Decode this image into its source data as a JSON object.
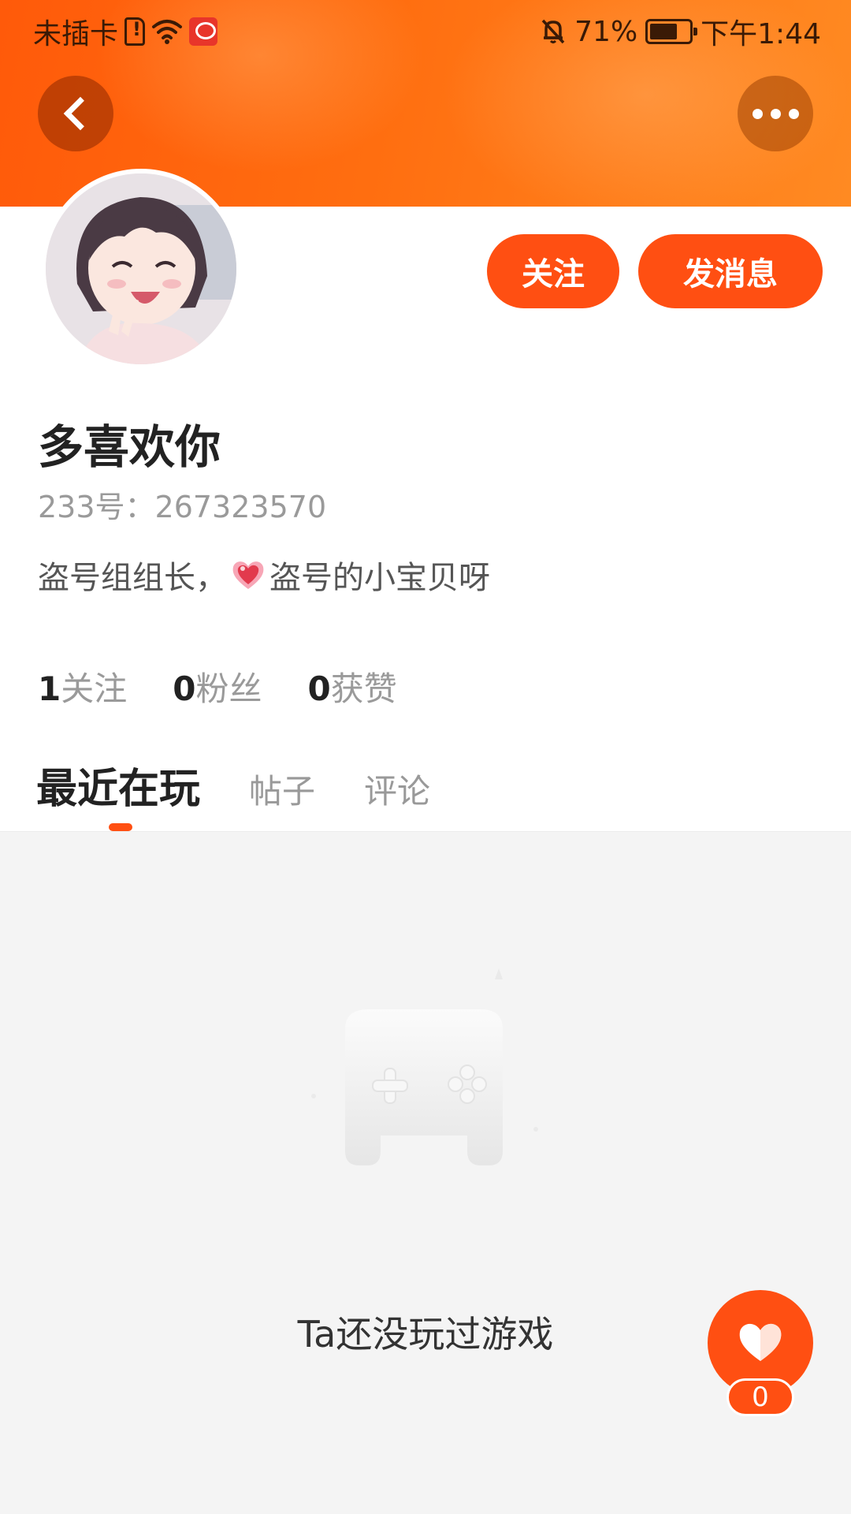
{
  "status_bar": {
    "carrier": "未插卡",
    "battery_percent": "71%",
    "battery_level": 0.71,
    "time": "下午1:44"
  },
  "header": {
    "back_icon": "chevron-left-icon",
    "more_icon": "more-horizontal-icon"
  },
  "profile": {
    "follow_label": "关注",
    "message_label": "发消息",
    "username": "多喜欢你",
    "user_id": "233号：267323570",
    "bio_before": "盗号组组长，",
    "bio_after": "盗号的小宝贝呀"
  },
  "stats": [
    {
      "value": "1",
      "label": "关注"
    },
    {
      "value": "0",
      "label": "粉丝"
    },
    {
      "value": "0",
      "label": "获赞"
    }
  ],
  "tabs": {
    "active": "最近在玩",
    "items": [
      "帖子",
      "评论"
    ]
  },
  "empty_state": {
    "icon": "gamepad-icon",
    "text": "Ta还没玩过游戏"
  },
  "like": {
    "icon": "heart-icon",
    "count": "0"
  },
  "colors": {
    "accent": "#ff4f12",
    "header_gradient_start": "#ff5a0a",
    "header_gradient_end": "#ff8a22"
  }
}
